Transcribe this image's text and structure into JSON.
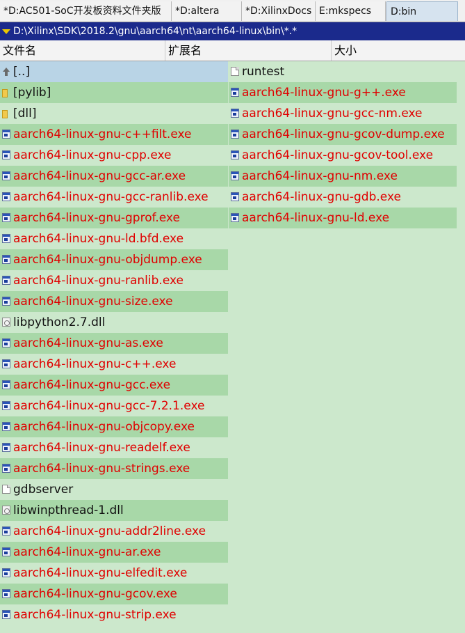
{
  "tabs": [
    {
      "label": "*D:AC501-SoC开发板资料文件夹版"
    },
    {
      "label": "*D:altera"
    },
    {
      "label": "*D:XilinxDocs"
    },
    {
      "label": "E:mkspecs"
    },
    {
      "label": "D:bin"
    }
  ],
  "path": "D:\\Xilinx\\SDK\\2018.2\\gnu\\aarch64\\nt\\aarch64-linux\\bin\\*.*",
  "columns": {
    "name": "文件名",
    "ext": "扩展名",
    "size": "大小"
  },
  "left_column": [
    {
      "name": "[..]",
      "kind": "up"
    },
    {
      "name": "[pylib]",
      "kind": "folder"
    },
    {
      "name": "[dll]",
      "kind": "folder"
    },
    {
      "name": "aarch64-linux-gnu-c++filt.exe",
      "kind": "exe"
    },
    {
      "name": "aarch64-linux-gnu-cpp.exe",
      "kind": "exe"
    },
    {
      "name": "aarch64-linux-gnu-gcc-ar.exe",
      "kind": "exe"
    },
    {
      "name": "aarch64-linux-gnu-gcc-ranlib.exe",
      "kind": "exe"
    },
    {
      "name": "aarch64-linux-gnu-gprof.exe",
      "kind": "exe"
    },
    {
      "name": "aarch64-linux-gnu-ld.bfd.exe",
      "kind": "exe"
    },
    {
      "name": "aarch64-linux-gnu-objdump.exe",
      "kind": "exe"
    },
    {
      "name": "aarch64-linux-gnu-ranlib.exe",
      "kind": "exe"
    },
    {
      "name": "aarch64-linux-gnu-size.exe",
      "kind": "exe"
    },
    {
      "name": "libpython2.7.dll",
      "kind": "dll"
    },
    {
      "name": "aarch64-linux-gnu-as.exe",
      "kind": "exe"
    },
    {
      "name": "aarch64-linux-gnu-c++.exe",
      "kind": "exe"
    },
    {
      "name": "aarch64-linux-gnu-gcc.exe",
      "kind": "exe"
    },
    {
      "name": "aarch64-linux-gnu-gcc-7.2.1.exe",
      "kind": "exe"
    },
    {
      "name": "aarch64-linux-gnu-objcopy.exe",
      "kind": "exe"
    },
    {
      "name": "aarch64-linux-gnu-readelf.exe",
      "kind": "exe"
    },
    {
      "name": "aarch64-linux-gnu-strings.exe",
      "kind": "exe"
    },
    {
      "name": "gdbserver",
      "kind": "file"
    },
    {
      "name": "libwinpthread-1.dll",
      "kind": "dll"
    },
    {
      "name": "aarch64-linux-gnu-addr2line.exe",
      "kind": "exe"
    },
    {
      "name": "aarch64-linux-gnu-ar.exe",
      "kind": "exe"
    },
    {
      "name": "aarch64-linux-gnu-elfedit.exe",
      "kind": "exe"
    },
    {
      "name": "aarch64-linux-gnu-gcov.exe",
      "kind": "exe"
    },
    {
      "name": "aarch64-linux-gnu-strip.exe",
      "kind": "exe"
    }
  ],
  "right_column": [
    {
      "name": "runtest",
      "kind": "file"
    },
    {
      "name": "aarch64-linux-gnu-g++.exe",
      "kind": "exe"
    },
    {
      "name": "aarch64-linux-gnu-gcc-nm.exe",
      "kind": "exe"
    },
    {
      "name": "aarch64-linux-gnu-gcov-dump.exe",
      "kind": "exe"
    },
    {
      "name": "aarch64-linux-gnu-gcov-tool.exe",
      "kind": "exe"
    },
    {
      "name": "aarch64-linux-gnu-nm.exe",
      "kind": "exe"
    },
    {
      "name": "aarch64-linux-gnu-gdb.exe",
      "kind": "exe"
    },
    {
      "name": "aarch64-linux-gnu-ld.exe",
      "kind": "exe"
    }
  ],
  "colors": {
    "background": "#cce8cc",
    "band": "#a8d8a8",
    "selected": "#b9d4e6",
    "exe_text": "#e00000",
    "path_bar": "#1b2a8c"
  }
}
